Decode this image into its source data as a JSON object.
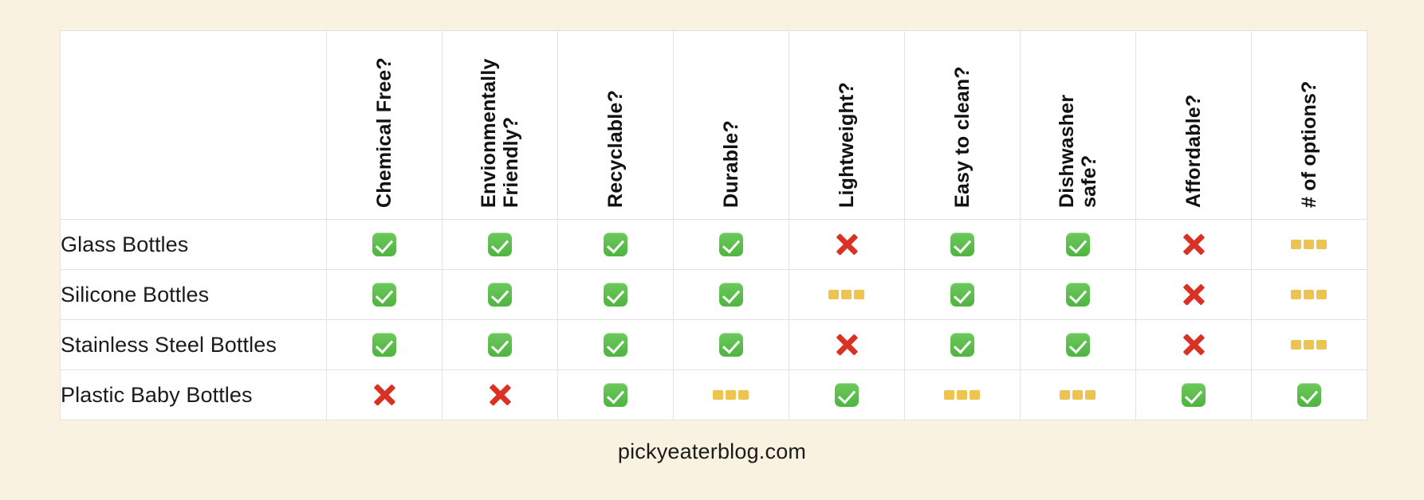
{
  "background_color": "#faf2e1",
  "table": {
    "corner_header": "",
    "column_headers": [
      "Chemical Free?",
      "Envionmentally\nFriendly?",
      "Recyclable?",
      "Durable?",
      "Lightweight?",
      "Easy to clean?",
      "Dishwasher\nsafe?",
      "Affordable?",
      "# of options?"
    ],
    "rows": [
      {
        "label": "Glass Bottles",
        "values": [
          "check",
          "check",
          "check",
          "check",
          "cross",
          "check",
          "check",
          "cross",
          "dash"
        ]
      },
      {
        "label": "Silicone Bottles",
        "values": [
          "check",
          "check",
          "check",
          "check",
          "dash",
          "check",
          "check",
          "cross",
          "dash"
        ]
      },
      {
        "label": "Stainless Steel Bottles",
        "values": [
          "check",
          "check",
          "check",
          "check",
          "cross",
          "check",
          "check",
          "cross",
          "dash"
        ]
      },
      {
        "label": "Plastic Baby Bottles",
        "values": [
          "cross",
          "cross",
          "check",
          "dash",
          "check",
          "dash",
          "dash",
          "check",
          "check"
        ]
      }
    ]
  },
  "icons": {
    "check": {
      "name": "green-check-icon",
      "color": "#58bd49"
    },
    "cross": {
      "name": "red-cross-icon",
      "color": "#da3124"
    },
    "dash": {
      "name": "yellow-dash-icon",
      "color": "#eec450"
    }
  },
  "footer": {
    "source": "pickyeaterblog.com"
  }
}
